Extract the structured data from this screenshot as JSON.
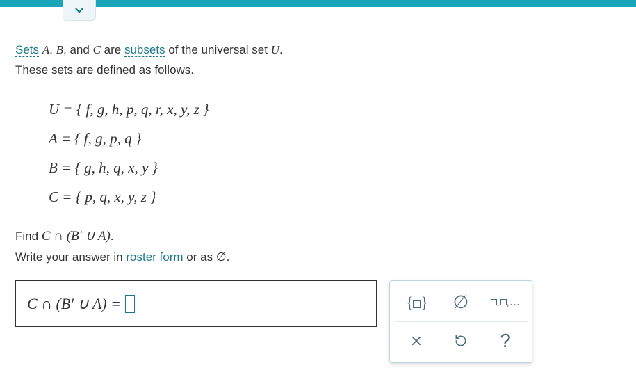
{
  "topbar": {
    "color": "#1ba5b8"
  },
  "problem": {
    "intro_pre": "Sets",
    "intro_mid": "and",
    "intro_post": "are",
    "intro_end": "of the universal set",
    "intro_period": ".",
    "sets_word": "Sets",
    "subsets_word": "subsets",
    "line2": "These sets are defined as follows.",
    "varA": "A",
    "varB": "B",
    "varC": "C",
    "varU": "U",
    "defU": "U = { f, g, h, p, q, r, x, y, z }",
    "defA": "A = { f, g, p, q }",
    "defB": "B = { g, h, q, x, y }",
    "defC": "C = { p, q, x, y, z }",
    "find_pre": "Find",
    "find_expr": "C ∩ (B′ ∪ A)",
    "find_period": ".",
    "write_pre": "Write your answer in",
    "roster_word": "roster form",
    "write_post": "or as",
    "empty_sym": "∅",
    "write_period": "."
  },
  "answer": {
    "lhs": "C ∩ (B′ ∪ A) ="
  },
  "tools": {
    "braces": "{☐}",
    "empty": "∅",
    "list": "☐,☐,...",
    "clear": "×",
    "reset": "↺",
    "help": "?"
  }
}
